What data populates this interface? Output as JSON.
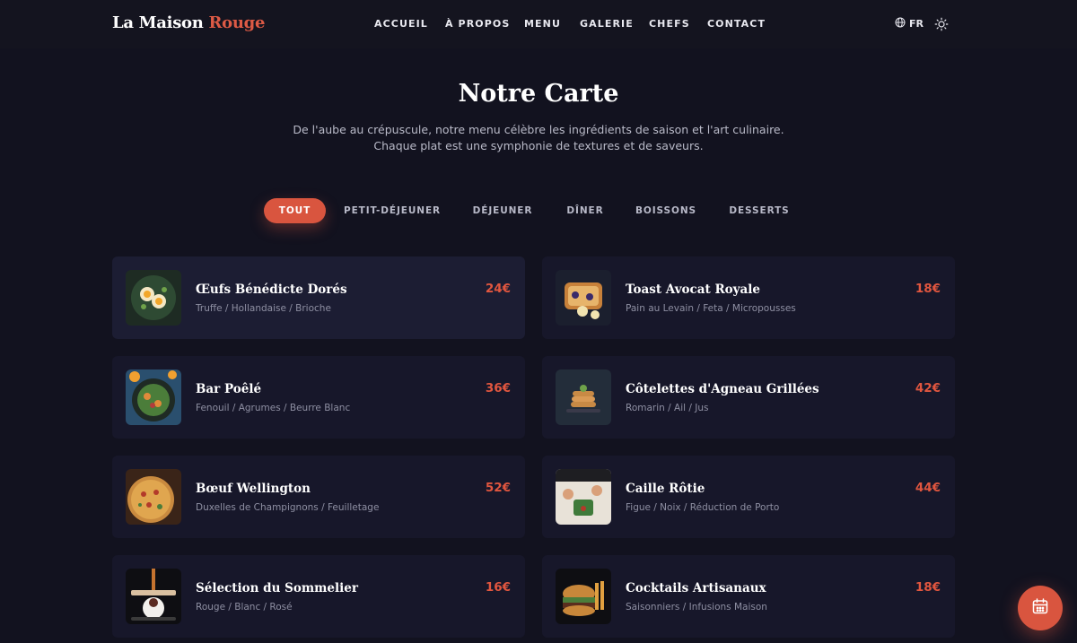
{
  "header": {
    "logo_main": "La Maison",
    "logo_accent": "Rouge",
    "nav": [
      "ACCUEIL",
      "À PROPOS",
      "MENU",
      "GALERIE",
      "CHEFS",
      "CONTACT"
    ],
    "language": "FR",
    "language_icon": "globe-icon",
    "theme_icon": "sun-icon"
  },
  "hero": {
    "title": "Notre Carte",
    "subtitle_line1": "De l'aube au crépuscule, notre menu célèbre les ingrédients de saison et l'art culinaire.",
    "subtitle_line2": "Chaque plat est une symphonie de textures et de saveurs."
  },
  "tabs": [
    "TOUT",
    "PETIT-DÉJEUNER",
    "DÉJEUNER",
    "DÎNER",
    "BOISSONS",
    "DESSERTS"
  ],
  "active_tab": "TOUT",
  "colors": {
    "accent": "#d9553f",
    "background": "#12121f",
    "card": "#17172a"
  },
  "menu": [
    {
      "name": "Œufs Bénédicte Dorés",
      "desc": "Truffe / Hollandaise / Brioche",
      "price": "24€"
    },
    {
      "name": "Toast Avocat Royale",
      "desc": "Pain au Levain / Feta / Micropousses",
      "price": "18€"
    },
    {
      "name": "Bar Poêlé",
      "desc": "Fenouil / Agrumes / Beurre Blanc",
      "price": "36€"
    },
    {
      "name": "Côtelettes d'Agneau Grillées",
      "desc": "Romarin / Ail / Jus",
      "price": "42€"
    },
    {
      "name": "Bœuf Wellington",
      "desc": "Duxelles de Champignons / Feuilletage",
      "price": "52€"
    },
    {
      "name": "Caille Rôtie",
      "desc": "Figue / Noix / Réduction de Porto",
      "price": "44€"
    },
    {
      "name": "Sélection du Sommelier",
      "desc": "Rouge / Blanc / Rosé",
      "price": "16€"
    },
    {
      "name": "Cocktails Artisanaux",
      "desc": "Saisonniers / Infusions Maison",
      "price": "18€"
    }
  ],
  "fab_icon": "calendar-icon"
}
